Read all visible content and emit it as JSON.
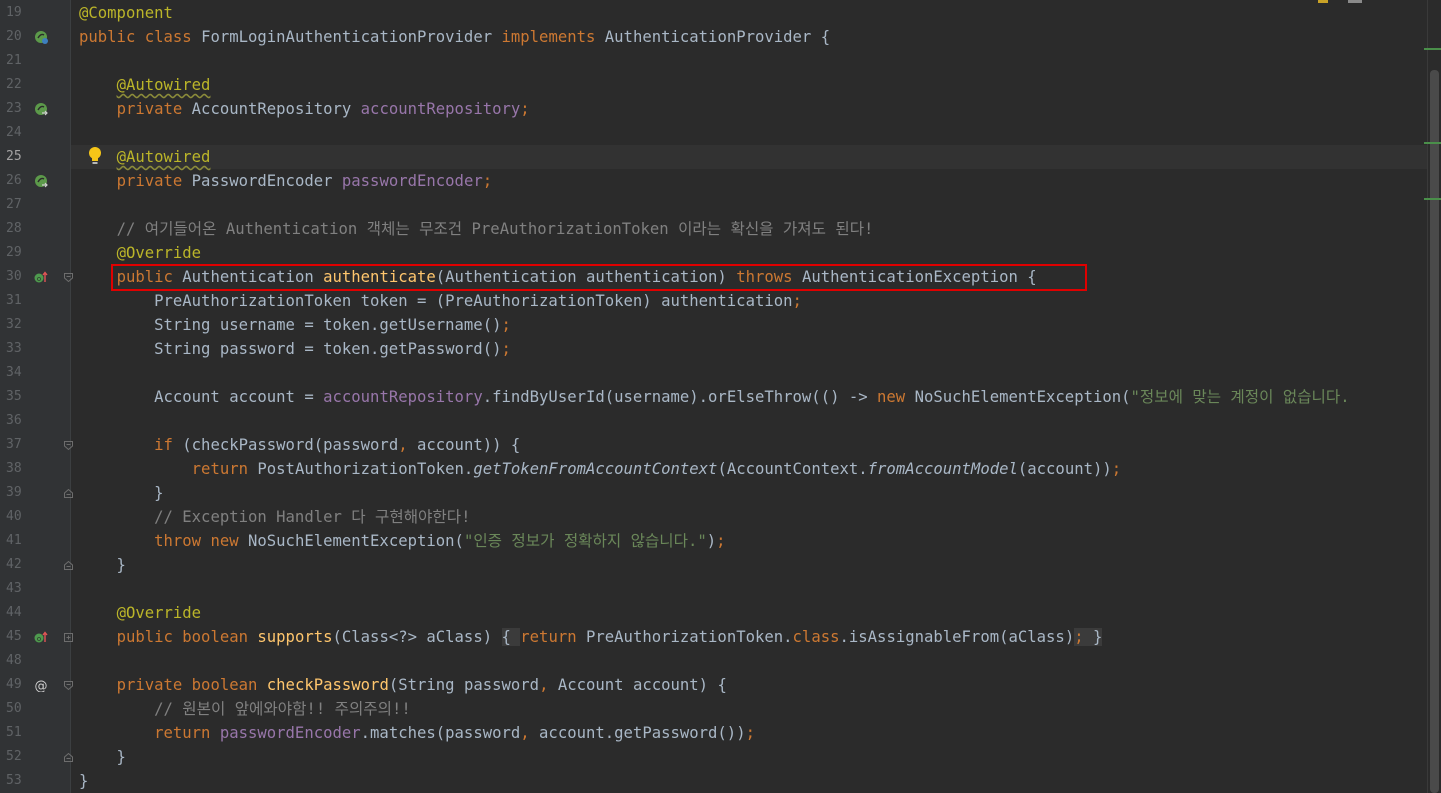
{
  "lines": [
    {
      "n": "19",
      "tokens": [
        {
          "t": "@Component",
          "c": "ann"
        }
      ]
    },
    {
      "n": "20",
      "icon": "spring-bean-icon",
      "tokens": [
        {
          "t": "public class ",
          "c": "kw"
        },
        {
          "t": "FormLoginAuthenticationProvider "
        },
        {
          "t": "implements ",
          "c": "kw"
        },
        {
          "t": "AuthenticationProvider {"
        }
      ]
    },
    {
      "n": "21",
      "tokens": []
    },
    {
      "n": "22",
      "tokens": [
        {
          "t": "    "
        },
        {
          "t": "@Autowired",
          "c": "ann warn"
        }
      ]
    },
    {
      "n": "23",
      "icon": "spring-autowired-icon",
      "tokens": [
        {
          "t": "    "
        },
        {
          "t": "private ",
          "c": "kw"
        },
        {
          "t": "AccountRepository "
        },
        {
          "t": "accountRepository",
          "c": "fld"
        },
        {
          "t": ";",
          "c": "kw"
        }
      ]
    },
    {
      "n": "24",
      "tokens": []
    },
    {
      "n": "25",
      "current": true,
      "tokens": [
        {
          "t": "    "
        },
        {
          "t": "@Autowired",
          "c": "ann warn"
        }
      ]
    },
    {
      "n": "26",
      "icon": "spring-autowired-icon",
      "tokens": [
        {
          "t": "    "
        },
        {
          "t": "private ",
          "c": "kw"
        },
        {
          "t": "PasswordEncoder "
        },
        {
          "t": "passwordEncoder",
          "c": "fld"
        },
        {
          "t": ";",
          "c": "kw"
        }
      ]
    },
    {
      "n": "27",
      "tokens": []
    },
    {
      "n": "28",
      "tokens": [
        {
          "t": "    "
        },
        {
          "t": "// 여기들어온 Authentication 객체는 무조건 PreAuthorizationToken 이라는 확신을 가져도 된다!",
          "c": "cmt"
        }
      ]
    },
    {
      "n": "29",
      "tokens": [
        {
          "t": "    "
        },
        {
          "t": "@Override",
          "c": "ann"
        }
      ]
    },
    {
      "n": "30",
      "icon": "override-icon",
      "fold": "open",
      "tokens": [
        {
          "t": "    "
        },
        {
          "t": "public ",
          "c": "kw"
        },
        {
          "t": "Authentication "
        },
        {
          "t": "authenticate",
          "c": "mth"
        },
        {
          "t": "(Authentication authentication) "
        },
        {
          "t": "throws ",
          "c": "kw"
        },
        {
          "t": "AuthenticationException {"
        }
      ]
    },
    {
      "n": "31",
      "tokens": [
        {
          "t": "        PreAuthorizationToken token = (PreAuthorizationToken) authentication"
        },
        {
          "t": ";",
          "c": "kw"
        }
      ]
    },
    {
      "n": "32",
      "tokens": [
        {
          "t": "        String username = token.getUsername()"
        },
        {
          "t": ";",
          "c": "kw"
        }
      ]
    },
    {
      "n": "33",
      "tokens": [
        {
          "t": "        String password = token.getPassword()"
        },
        {
          "t": ";",
          "c": "kw"
        }
      ]
    },
    {
      "n": "34",
      "tokens": []
    },
    {
      "n": "35",
      "tokens": [
        {
          "t": "        Account account = "
        },
        {
          "t": "accountRepository",
          "c": "fld"
        },
        {
          "t": ".findByUserId(username).orElseThrow(() -> "
        },
        {
          "t": "new ",
          "c": "kw"
        },
        {
          "t": "NoSuchElementException("
        },
        {
          "t": "\"정보에 맞는 계정이 없습니다.",
          "c": "str"
        }
      ]
    },
    {
      "n": "36",
      "tokens": []
    },
    {
      "n": "37",
      "fold": "open",
      "tokens": [
        {
          "t": "        "
        },
        {
          "t": "if ",
          "c": "kw"
        },
        {
          "t": "(checkPassword(password"
        },
        {
          "t": ", ",
          "c": "kw"
        },
        {
          "t": "account)) {"
        }
      ]
    },
    {
      "n": "38",
      "tokens": [
        {
          "t": "            "
        },
        {
          "t": "return ",
          "c": "kw"
        },
        {
          "t": "PostAuthorizationToken."
        },
        {
          "t": "getTokenFromAccountContext",
          "c": "it"
        },
        {
          "t": "(AccountContext."
        },
        {
          "t": "fromAccountModel",
          "c": "it"
        },
        {
          "t": "(account))"
        },
        {
          "t": ";",
          "c": "kw"
        }
      ]
    },
    {
      "n": "39",
      "fold": "close",
      "tokens": [
        {
          "t": "        }"
        }
      ]
    },
    {
      "n": "40",
      "tokens": [
        {
          "t": "        "
        },
        {
          "t": "// Exception Handler 다 구현해야한다!",
          "c": "cmt"
        }
      ]
    },
    {
      "n": "41",
      "tokens": [
        {
          "t": "        "
        },
        {
          "t": "throw new ",
          "c": "kw"
        },
        {
          "t": "NoSuchElementException("
        },
        {
          "t": "\"인증 정보가 정확하지 않습니다.\"",
          "c": "str"
        },
        {
          "t": ")"
        },
        {
          "t": ";",
          "c": "kw"
        }
      ]
    },
    {
      "n": "42",
      "fold": "close",
      "tokens": [
        {
          "t": "    }"
        }
      ]
    },
    {
      "n": "43",
      "tokens": []
    },
    {
      "n": "44",
      "tokens": [
        {
          "t": "    "
        },
        {
          "t": "@Override",
          "c": "ann"
        }
      ]
    },
    {
      "n": "45",
      "icon": "override-icon",
      "fold": "collapsed",
      "tokens": [
        {
          "t": "    "
        },
        {
          "t": "public boolean ",
          "c": "kw"
        },
        {
          "t": "supports",
          "c": "mth"
        },
        {
          "t": "(Class<?> aClass) "
        },
        {
          "t": "{ ",
          "c": "brace-bg"
        },
        {
          "t": "return ",
          "c": "kw"
        },
        {
          "t": "PreAuthorizationToken."
        },
        {
          "t": "class",
          "c": "kw"
        },
        {
          "t": ".isAssignableFrom(aClass)"
        },
        {
          "t": ";",
          "c": "kw brace-bg"
        },
        {
          "t": " }",
          "c": "brace-bg"
        }
      ]
    },
    {
      "n": "48",
      "tokens": []
    },
    {
      "n": "49",
      "icon": "at-icon",
      "fold": "open",
      "tokens": [
        {
          "t": "    "
        },
        {
          "t": "private boolean ",
          "c": "kw"
        },
        {
          "t": "checkPassword",
          "c": "mth"
        },
        {
          "t": "(String password"
        },
        {
          "t": ", ",
          "c": "kw"
        },
        {
          "t": "Account account) {"
        }
      ]
    },
    {
      "n": "50",
      "tokens": [
        {
          "t": "        "
        },
        {
          "t": "// 원본이 앞에와야함!! 주의주의!!",
          "c": "cmt"
        }
      ]
    },
    {
      "n": "51",
      "tokens": [
        {
          "t": "        "
        },
        {
          "t": "return ",
          "c": "kw"
        },
        {
          "t": "passwordEncoder",
          "c": "fld"
        },
        {
          "t": ".matches(password"
        },
        {
          "t": ", ",
          "c": "kw"
        },
        {
          "t": "account.getPassword())"
        },
        {
          "t": ";",
          "c": "kw"
        }
      ]
    },
    {
      "n": "52",
      "fold": "close",
      "tokens": [
        {
          "t": "    }"
        }
      ]
    },
    {
      "n": "53",
      "tokens": [
        {
          "t": "}"
        }
      ]
    }
  ],
  "colors": {
    "background": "#2b2b2b",
    "gutter": "#313335",
    "keyword": "#cc7832",
    "annotation": "#bbb529",
    "field": "#9876aa",
    "method": "#ffc66d",
    "string": "#6a8759",
    "comment": "#808080",
    "highlight_box": "#e00000"
  }
}
